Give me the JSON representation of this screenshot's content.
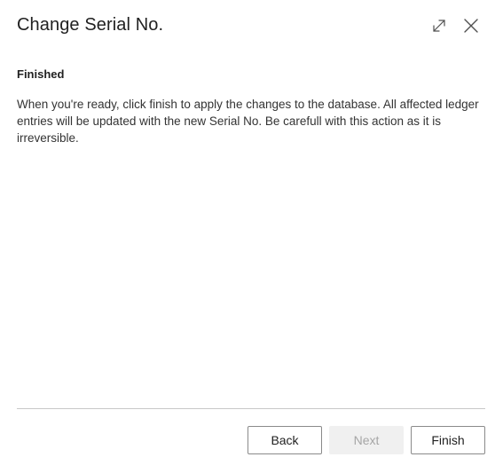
{
  "dialog": {
    "title": "Change Serial No.",
    "icons": {
      "expand": "expand-icon",
      "close": "close-icon"
    }
  },
  "content": {
    "heading": "Finished",
    "body": "When you're ready, click finish to apply the changes to the database. All affected ledger entries will be updated with the new Serial No. Be carefull with this action as it is irreversible."
  },
  "footer": {
    "back_label": "Back",
    "next_label": "Next",
    "finish_label": "Finish",
    "next_enabled": false
  }
}
